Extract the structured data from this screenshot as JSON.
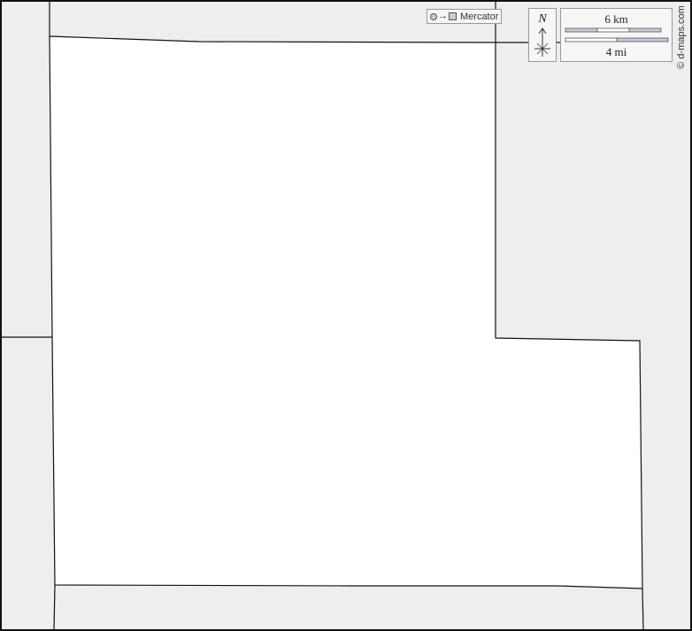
{
  "map": {
    "projection_label": "Mercator",
    "north_label": "N",
    "scale_km_label": "6 km",
    "scale_mi_label": "4 mi",
    "credit": "© d-maps.com"
  },
  "colors": {
    "outside_fill": "#eeeeee",
    "region_fill": "#ffffff",
    "border_stroke": "#111111",
    "scale_bar_fill": "#c8c8d8"
  },
  "icons": {
    "projection": [
      "circle-icon",
      "arrow-right-icon",
      "square-icon"
    ],
    "north_arrow": "north-arrow-icon"
  }
}
